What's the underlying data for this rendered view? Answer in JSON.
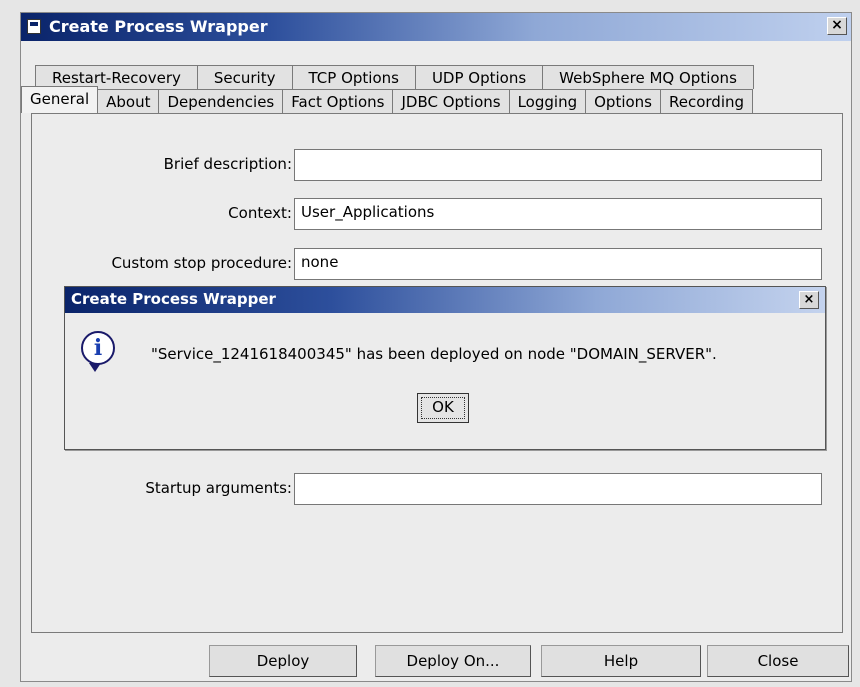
{
  "window": {
    "title": "Create Process Wrapper",
    "close_label": "×"
  },
  "tabs": {
    "row1": [
      "Restart-Recovery",
      "Security",
      "TCP Options",
      "UDP Options",
      "WebSphere MQ Options"
    ],
    "row2": [
      "General",
      "About",
      "Dependencies",
      "Fact Options",
      "JDBC Options",
      "Logging",
      "Options",
      "Recording"
    ]
  },
  "form": {
    "brief_description_label": "Brief description:",
    "brief_description_value": "",
    "context_label": "Context:",
    "context_value": "User_Applications",
    "custom_stop_label": "Custom stop procedure:",
    "custom_stop_value": "none",
    "startup_args_label": "Startup arguments:",
    "startup_args_value": ""
  },
  "dialog": {
    "title": "Create Process Wrapper",
    "close_label": "×",
    "message": "\"Service_1241618400345\" has been deployed on node \"DOMAIN_SERVER\".",
    "ok_label": "OK",
    "icon": "info-icon"
  },
  "buttons": {
    "deploy": "Deploy",
    "deploy_on": "Deploy On...",
    "help": "Help",
    "close": "Close"
  }
}
